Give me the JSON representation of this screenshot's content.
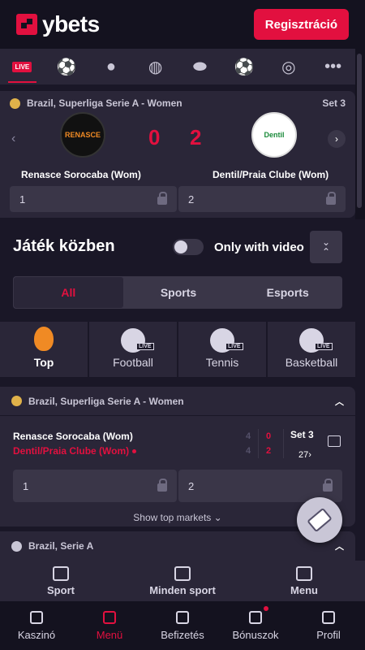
{
  "header": {
    "logo_text": "ybets",
    "register_label": "Regisztráció"
  },
  "sport_strip": {
    "items": [
      {
        "icon": "live-icon",
        "label": "LIVE"
      },
      {
        "icon": "football-icon"
      },
      {
        "icon": "tennis-icon"
      },
      {
        "icon": "basketball-icon"
      },
      {
        "icon": "ice-hockey-icon"
      },
      {
        "icon": "futsal-icon"
      },
      {
        "icon": "volleyball-icon"
      },
      {
        "icon": "more-icon",
        "label": "•••"
      }
    ]
  },
  "featured": {
    "league": "Brazil, Superliga Serie A - Women",
    "set": "Set 3",
    "home_logo_text": "RENASCE",
    "away_logo_text": "Dentil",
    "home_score": "0",
    "away_score": "2",
    "home_team": "Renasce Sorocaba (Wom)",
    "away_team": "Dentil/Praia Clube (Wom)",
    "odd1_label": "1",
    "odd2_label": "2"
  },
  "inplay": {
    "title": "Játék közben",
    "only_video_label": "Only with video"
  },
  "tabs": [
    "All",
    "Sports",
    "Esports"
  ],
  "categories": [
    {
      "label": "Top",
      "icon": "flame-icon"
    },
    {
      "label": "Football",
      "icon": "football-live-icon",
      "badge": "LIVE"
    },
    {
      "label": "Tennis",
      "icon": "tennis-live-icon",
      "badge": "LIVE"
    },
    {
      "label": "Basketball",
      "icon": "basketball-live-icon",
      "badge": "LIVE"
    }
  ],
  "league_block": {
    "league": "Brazil, Superliga Serie A - Women",
    "home": "Renasce Sorocaba (Wom)",
    "away": "Dentil/Praia Clube (Wom)",
    "home_games": "4",
    "away_games": "4",
    "home_points": "0",
    "away_points": "2",
    "set": "Set 3",
    "more_markets": "27",
    "odd1_label": "1",
    "odd2_label": "2",
    "show_top_markets": "Show top markets"
  },
  "league2": {
    "league": "Brazil, Serie A"
  },
  "subnav": [
    {
      "label": "Sport",
      "icon": "trophy-icon"
    },
    {
      "label": "Minden sport",
      "icon": "list-icon"
    },
    {
      "label": "Menu",
      "icon": "menu-icon"
    }
  ],
  "bottom_nav": [
    {
      "label": "Kaszinó",
      "icon": "home-icon"
    },
    {
      "label": "Menü",
      "icon": "menu-search-icon"
    },
    {
      "label": "Befizetés",
      "icon": "wallet-icon"
    },
    {
      "label": "Bónuszok",
      "icon": "gift-icon"
    },
    {
      "label": "Profil",
      "icon": "profile-icon"
    }
  ],
  "colors": {
    "accent": "#e2103f",
    "bg": "#1a1727",
    "card": "#2a2638"
  }
}
